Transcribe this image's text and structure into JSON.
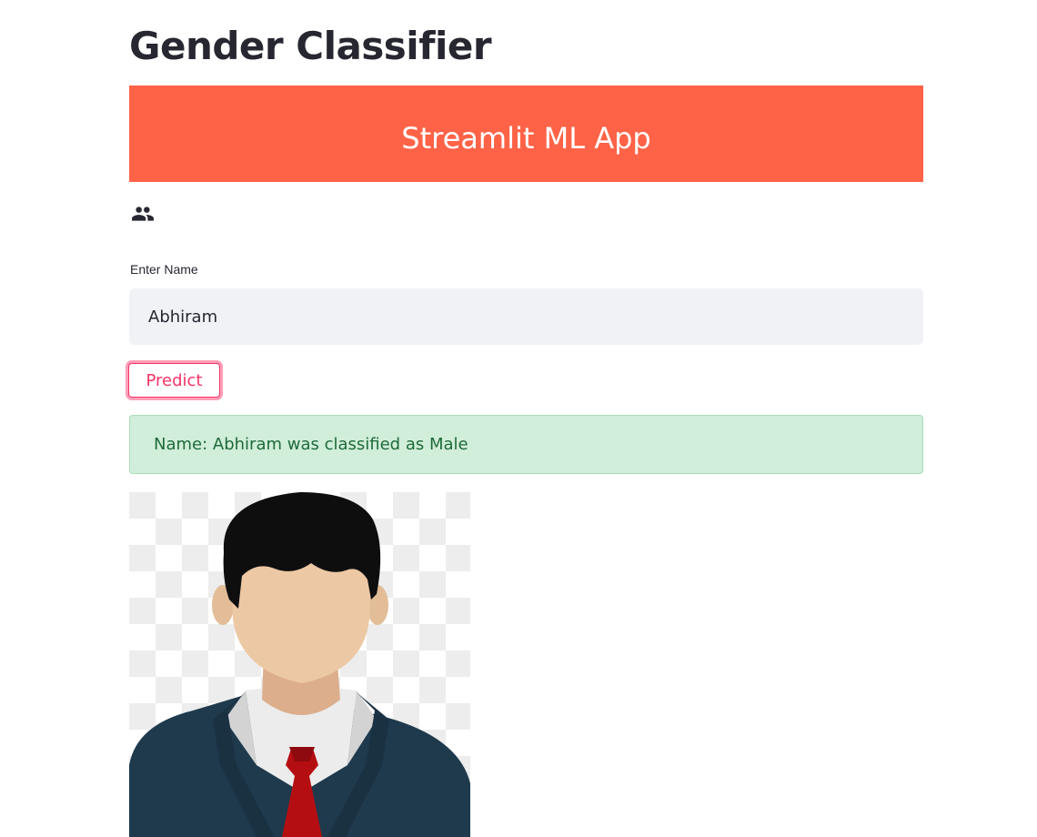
{
  "page": {
    "title": "Gender Classifier"
  },
  "banner": {
    "text": "Streamlit ML App",
    "background_color": "#ff6347"
  },
  "icons": {
    "header_icon": "people-icon",
    "avatar_image": "male-avatar-image"
  },
  "form": {
    "name_label": "Enter Name",
    "name_value": "Abhiram",
    "input_background": "#f0f2f6",
    "predict_label": "Predict",
    "predict_color": "#f63366"
  },
  "result": {
    "message": "Name: Abhiram was classified as Male",
    "background_color": "#d0eed9",
    "border_color": "#a9dcb6",
    "text_color": "#1e6a3a"
  }
}
